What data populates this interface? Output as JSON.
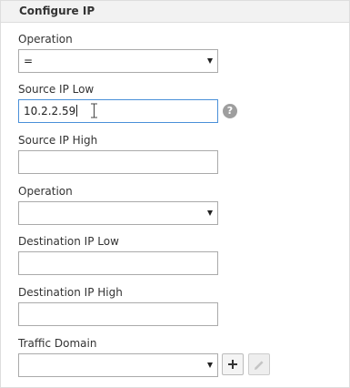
{
  "panel": {
    "title": "Configure IP"
  },
  "fields": {
    "operation1": {
      "label": "Operation",
      "value": "="
    },
    "source_ip_low": {
      "label": "Source IP Low",
      "value": "10.2.2.59"
    },
    "source_ip_high": {
      "label": "Source IP High",
      "value": ""
    },
    "operation2": {
      "label": "Operation",
      "value": ""
    },
    "destination_ip_low": {
      "label": "Destination IP Low",
      "value": ""
    },
    "destination_ip_high": {
      "label": "Destination IP High",
      "value": ""
    },
    "traffic_domain": {
      "label": "Traffic Domain",
      "value": ""
    }
  },
  "help": {
    "glyph": "?"
  },
  "icons": {
    "help": "question-circle-icon",
    "add": "plus-icon",
    "edit": "pencil-icon",
    "dropdown": "chevron-down-icon"
  },
  "colors": {
    "focus_border": "#4a90d9",
    "header_bg": "#f2f2f2",
    "help_icon_bg": "#9e9e9e"
  }
}
